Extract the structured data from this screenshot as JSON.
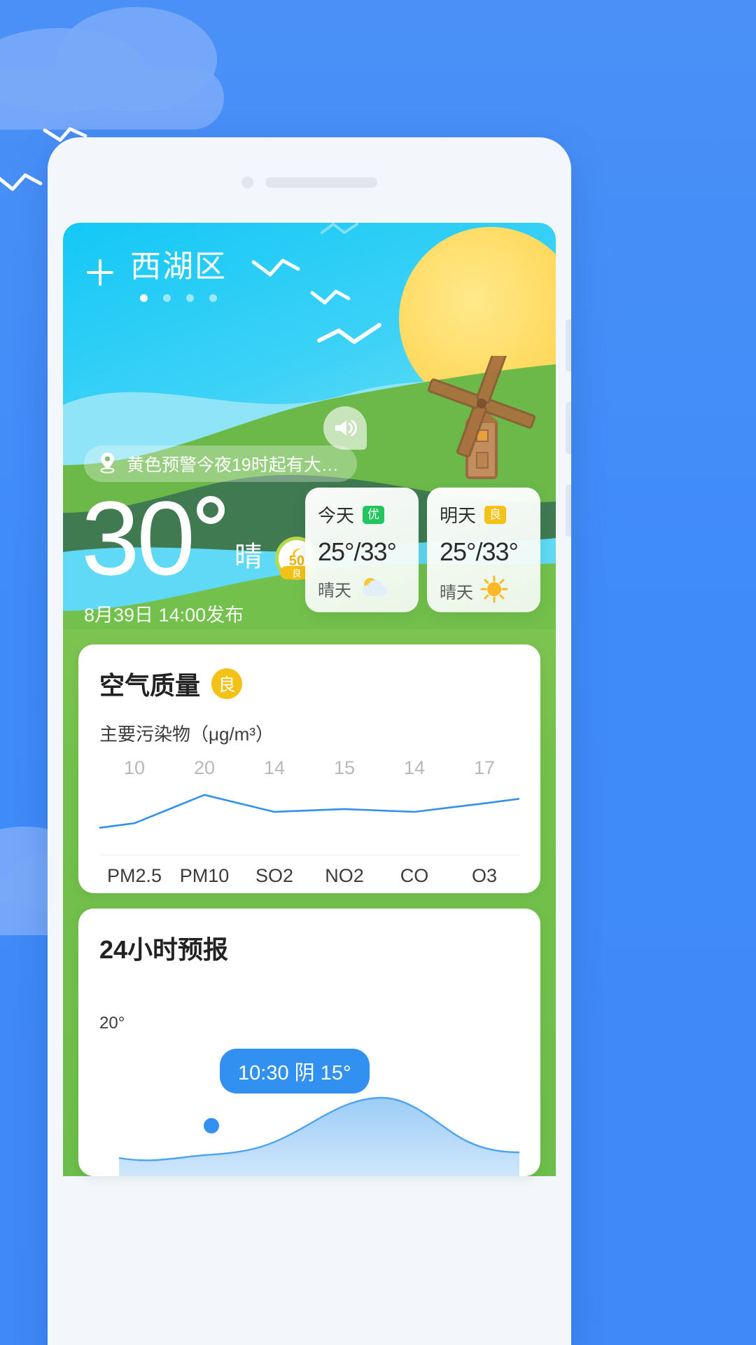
{
  "theme": {
    "page_bg": "#3f8cf8",
    "hero_sky": "#2ecdf5",
    "hill_green": "#6cb94a",
    "accent_blue": "#3291f0",
    "good_green": "#22c55e",
    "fair_yellow": "#f4c117"
  },
  "header": {
    "add_city_icon": "plus-icon",
    "city": "西湖区",
    "page_dots": 4,
    "active_dot": 0
  },
  "hero": {
    "speaker_icon": "speaker-icon",
    "windmill_icon": "windmill-icon",
    "sun_icon": "sun-icon",
    "alert": {
      "icon": "location-pin-icon",
      "text": "黄色预警今夜19时起有大…"
    },
    "temperature": "30",
    "degree_symbol": "°",
    "condition": "晴",
    "aqi_badge": {
      "icon": "leaf-icon",
      "value": "50",
      "level": "良"
    },
    "published": "8月39日 14:00发布"
  },
  "forecast_cards": [
    {
      "day": "今天",
      "tag": "优",
      "tag_color": "#22c55e",
      "temp": "25°/33°",
      "desc": "晴天",
      "icon": "sun-behind-cloud-icon"
    },
    {
      "day": "明天",
      "tag": "良",
      "tag_color": "#f4c117",
      "temp": "25°/33°",
      "desc": "晴天",
      "icon": "sun-icon"
    }
  ],
  "air_quality": {
    "title": "空气质量",
    "level": "良",
    "subtitle": "主要污染物（μg/m³）"
  },
  "chart_data": {
    "type": "line",
    "title": "主要污染物（μg/m³）",
    "categories": [
      "PM2.5",
      "PM10",
      "SO2",
      "NO2",
      "CO",
      "O3"
    ],
    "values": [
      10,
      20,
      14,
      15,
      14,
      17
    ],
    "xlabel": "",
    "ylabel": "μg/m³",
    "ylim": [
      0,
      24
    ],
    "grid": false,
    "legend": "none",
    "line_color": "#3291f0"
  },
  "hourly": {
    "title": "24小时预报",
    "y_label": "20°",
    "tooltip": "10:30 阴 15°",
    "tooltip_time": "10:30",
    "tooltip_condition": "阴",
    "tooltip_temp": "15°"
  }
}
